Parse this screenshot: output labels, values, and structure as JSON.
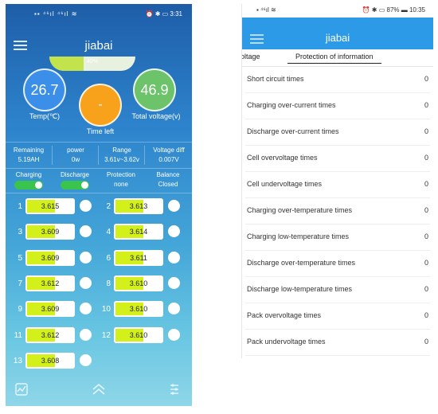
{
  "left": {
    "status": {
      "left": "▪▪ ⁴⁶ıl ⁴⁶ıl ≋",
      "right": "⏰ ✱ ▭ 3:31"
    },
    "title": "jiabai",
    "soc_pct": "40%",
    "soc_fraction": 0.4,
    "temp": {
      "value": "26.7",
      "label": "Temp(℃)"
    },
    "time_left": {
      "value": "-",
      "label": "Time left"
    },
    "total_voltage": {
      "value": "46.9",
      "label": "Total voltage(v)"
    },
    "stats": [
      {
        "label": "Remaining",
        "value": "5.19AH"
      },
      {
        "label": "power",
        "value": "0w"
      },
      {
        "label": "Range",
        "value": "3.61v~3.62v"
      },
      {
        "label": "Voltage diff",
        "value": "0.007V"
      }
    ],
    "charging": {
      "label": "Charging"
    },
    "discharge": {
      "label": "Discharge"
    },
    "protection": {
      "label": "Protection",
      "value": "none"
    },
    "balance": {
      "label": "Balance",
      "value": "Closed"
    },
    "cells": [
      {
        "index": "1",
        "voltage": "3.615"
      },
      {
        "index": "2",
        "voltage": "3.613"
      },
      {
        "index": "3",
        "voltage": "3.609"
      },
      {
        "index": "4",
        "voltage": "3.614"
      },
      {
        "index": "5",
        "voltage": "3.609"
      },
      {
        "index": "6",
        "voltage": "3.611"
      },
      {
        "index": "7",
        "voltage": "3.612"
      },
      {
        "index": "8",
        "voltage": "3.610"
      },
      {
        "index": "9",
        "voltage": "3.609"
      },
      {
        "index": "10",
        "voltage": "3.610"
      },
      {
        "index": "11",
        "voltage": "3.612"
      },
      {
        "index": "12",
        "voltage": "3.610"
      },
      {
        "index": "13",
        "voltage": "3.608"
      }
    ],
    "nav": {
      "left_icon": "chart-icon",
      "center_icon": "double-chevron-up-icon",
      "right_icon": "settings-list-icon"
    }
  },
  "right": {
    "status": {
      "left": "▪ ⁴⁶ıl ≋",
      "right": "⏰ ✱ ▭ 87% ▬ 10:35"
    },
    "title": "jiabai",
    "tabs": [
      {
        "label": "oltage"
      },
      {
        "label": "Protection of information"
      }
    ],
    "items": [
      {
        "label": "Short circuit times",
        "value": "0"
      },
      {
        "label": "Charging over-current times",
        "value": "0"
      },
      {
        "label": "Discharge over-current times",
        "value": "0"
      },
      {
        "label": "Cell overvoltage times",
        "value": "0"
      },
      {
        "label": "Cell undervoltage times",
        "value": "0"
      },
      {
        "label": "Charging over-temperature times",
        "value": "0"
      },
      {
        "label": "Charging low-temperature times",
        "value": "0"
      },
      {
        "label": "Discharge over-temperature times",
        "value": "0"
      },
      {
        "label": "Discharge low-temperature times",
        "value": "0"
      },
      {
        "label": "Pack overvoltage times",
        "value": "0"
      },
      {
        "label": "Pack undervoltage times",
        "value": "0"
      }
    ]
  },
  "colors": {
    "accent": "#2c9ae6",
    "temp_circle": "#3b8fe8",
    "time_circle": "#f7a21a",
    "volt_circle": "#6cc36a",
    "cell_fill": "#d3f01a",
    "toggle_on": "#3ac44e"
  }
}
